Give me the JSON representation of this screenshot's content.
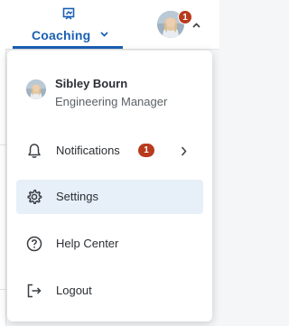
{
  "topbar": {
    "coaching_label": "Coaching",
    "coaching_icon": "coaching-icon",
    "account_badge": "1"
  },
  "menu": {
    "profile": {
      "name": "Sibley Bourn",
      "role": "Engineering Manager"
    },
    "items": [
      {
        "label": "Notifications",
        "icon": "bell-icon",
        "badge": "1"
      },
      {
        "label": "Settings",
        "icon": "gear-icon"
      },
      {
        "label": "Help Center",
        "icon": "help-circle-icon"
      },
      {
        "label": "Logout",
        "icon": "logout-icon"
      }
    ]
  },
  "colors": {
    "accent": "#1a5fb4",
    "badge": "#b83b1e",
    "active_item_bg": "#e7eff8"
  }
}
